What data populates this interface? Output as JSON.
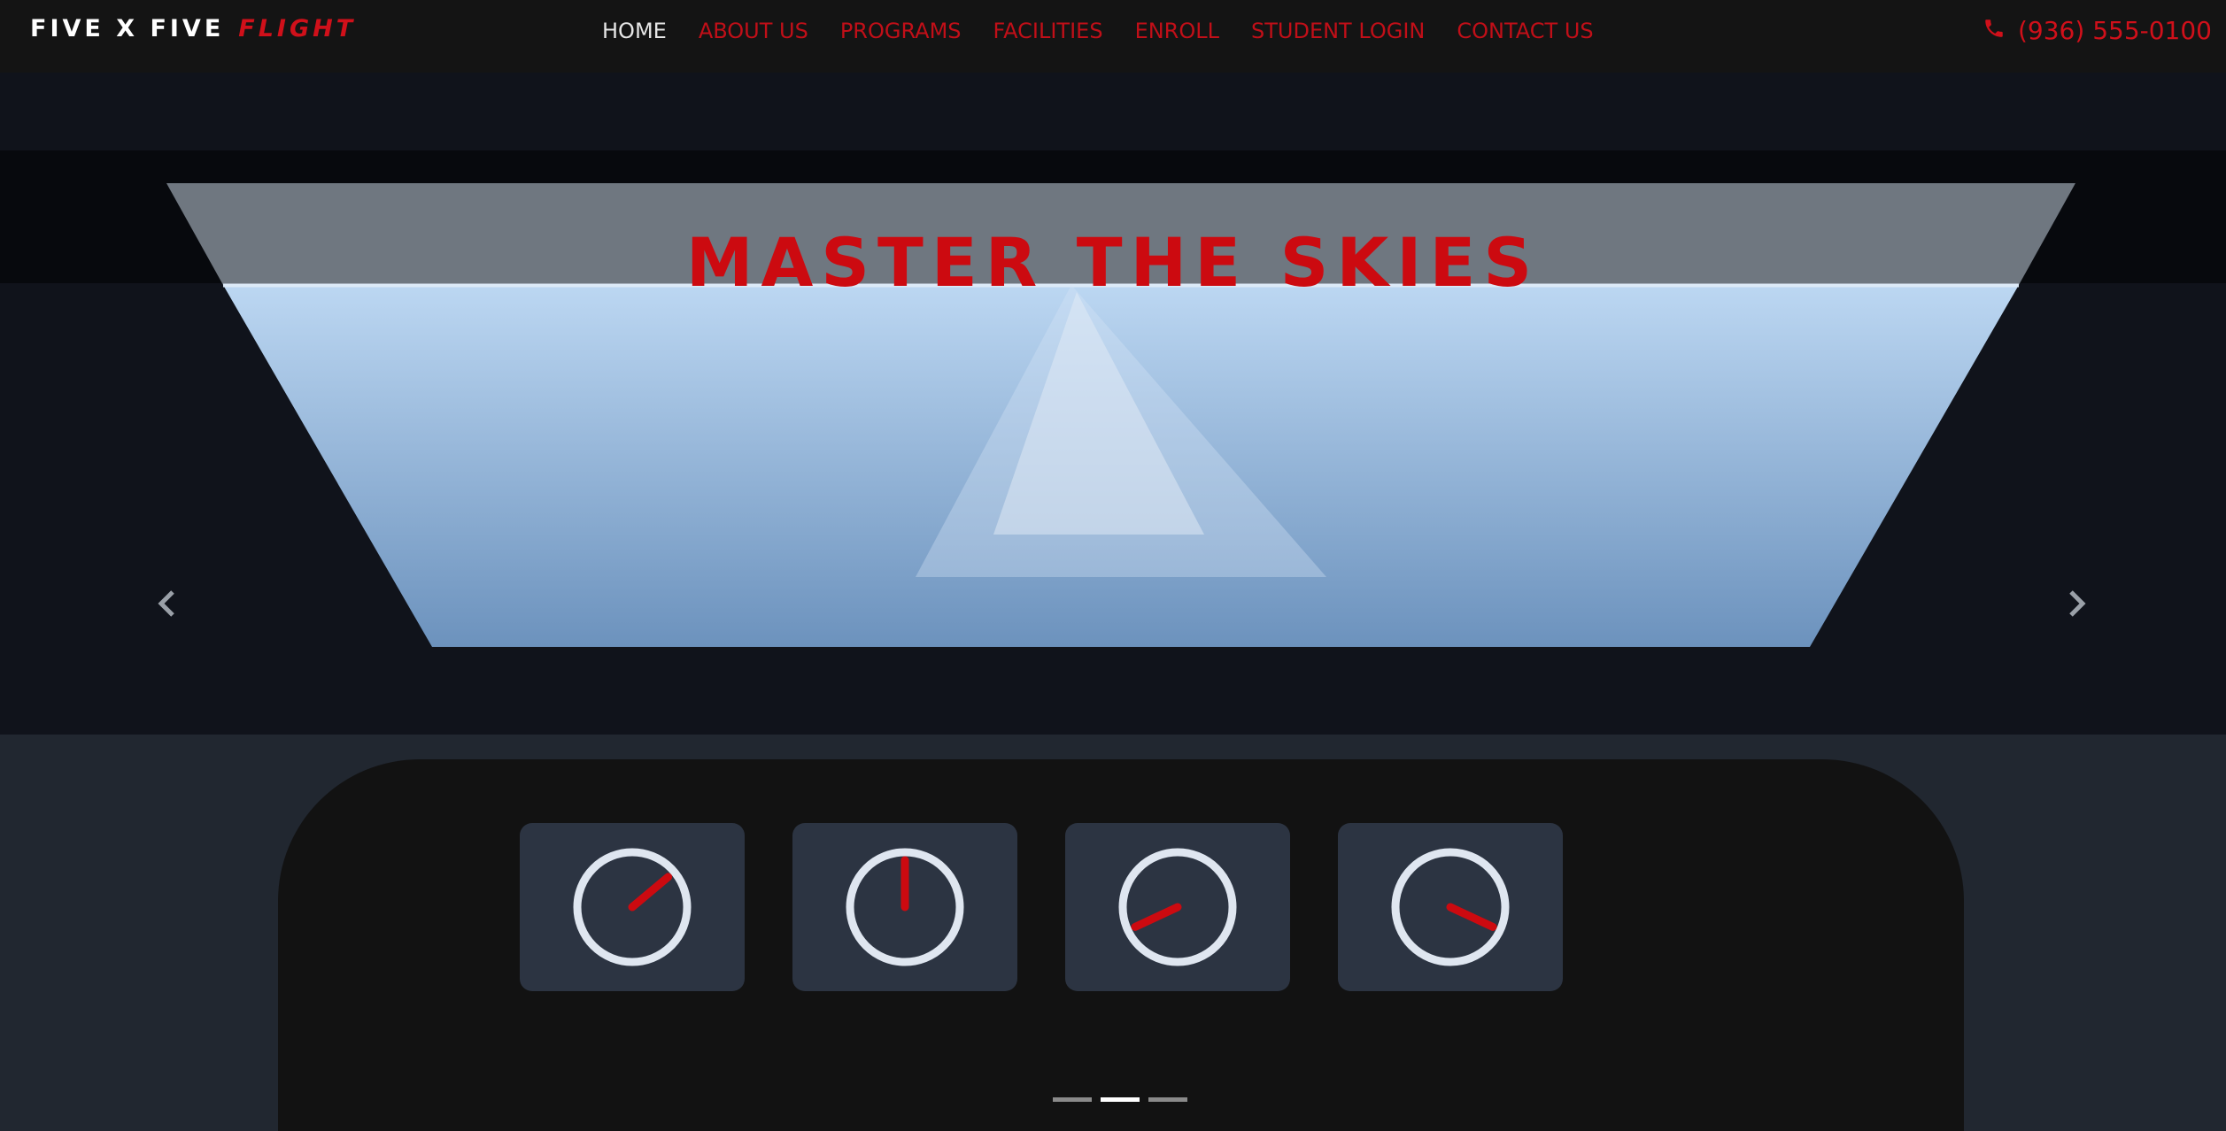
{
  "brand": {
    "part1": "FIVE X FIVE",
    "part2": "FLIGHT"
  },
  "nav": {
    "items": [
      {
        "label": "HOME",
        "active": true
      },
      {
        "label": "ABOUT US",
        "active": false
      },
      {
        "label": "PROGRAMS",
        "active": false
      },
      {
        "label": "FACILITIES",
        "active": false
      },
      {
        "label": "ENROLL",
        "active": false
      },
      {
        "label": "STUDENT LOGIN",
        "active": false
      },
      {
        "label": "CONTACT US",
        "active": false
      }
    ]
  },
  "phone": {
    "icon": "phone-icon",
    "number": "(936) 555-0100"
  },
  "hero": {
    "title": "MASTER THE SKIES",
    "prev_icon": "chevron-left-icon",
    "next_icon": "chevron-right-icon"
  },
  "dashboard": {
    "gauges": [
      {
        "name": "gauge-1",
        "needle_angle_deg": 50
      },
      {
        "name": "gauge-2",
        "needle_angle_deg": 0
      },
      {
        "name": "gauge-3",
        "needle_angle_deg": 245
      },
      {
        "name": "gauge-4",
        "needle_angle_deg": 115
      }
    ]
  },
  "carousel": {
    "slides": 3,
    "active_index": 1
  },
  "colors": {
    "accent": "#cc0a10",
    "nav_bg": "#141414",
    "hero_bg": "#10131b",
    "page_bg": "#212730",
    "gauge_bg": "#2c3442"
  }
}
